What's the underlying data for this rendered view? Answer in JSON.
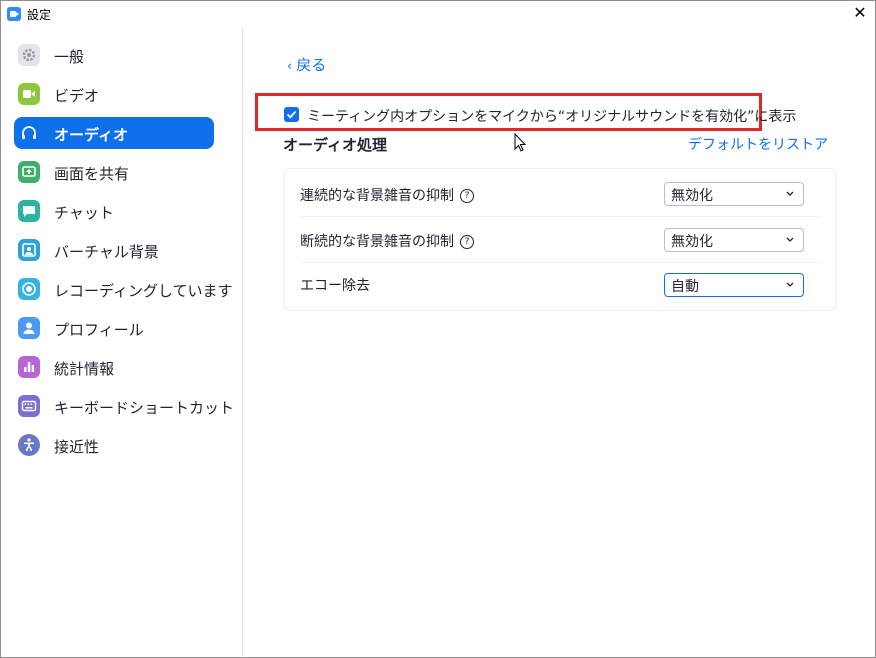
{
  "window": {
    "title": "設定",
    "close_glyph": "✕"
  },
  "sidebar": {
    "items": [
      {
        "label": "一般",
        "icon": "gear-icon",
        "color": "#9a9aa3",
        "active": false
      },
      {
        "label": "ビデオ",
        "icon": "video-icon",
        "color": "#8dc63f",
        "active": false
      },
      {
        "label": "オーディオ",
        "icon": "headphones-icon",
        "color": "#0e71eb",
        "active": true
      },
      {
        "label": "画面を共有",
        "icon": "share-screen-icon",
        "color": "#3fb06c",
        "active": false
      },
      {
        "label": "チャット",
        "icon": "chat-icon",
        "color": "#2bb3a3",
        "active": false
      },
      {
        "label": "バーチャル背景",
        "icon": "virtual-background-icon",
        "color": "#2fa3d8",
        "active": false
      },
      {
        "label": "レコーディングしています",
        "icon": "recording-icon",
        "color": "#34b3e4",
        "active": false
      },
      {
        "label": "プロフィール",
        "icon": "profile-icon",
        "color": "#4d9af4",
        "active": false
      },
      {
        "label": "統計情報",
        "icon": "statistics-icon",
        "color": "#b765d6",
        "active": false
      },
      {
        "label": "キーボードショートカット",
        "icon": "keyboard-icon",
        "color": "#7b6fd1",
        "active": false
      },
      {
        "label": "接近性",
        "icon": "accessibility-icon",
        "color": "#6a77c9",
        "active": false
      }
    ]
  },
  "main": {
    "back_label": "戻る",
    "checkbox_label": "ミーティング内オプションをマイクから“オリジナルサウンドを有効化”に表示",
    "checkbox_checked": true,
    "section_title": "オーディオ処理",
    "restore_label": "デフォルトをリストア",
    "help_glyph": "?",
    "settings": [
      {
        "label": "連続的な背景雑音の抑制",
        "has_help": true,
        "value": "無効化"
      },
      {
        "label": "断続的な背景雑音の抑制",
        "has_help": true,
        "value": "無効化"
      },
      {
        "label": "エコー除去",
        "has_help": false,
        "value": "自動"
      }
    ]
  },
  "colors": {
    "accent": "#0e71eb",
    "highlight": "#e02828"
  }
}
